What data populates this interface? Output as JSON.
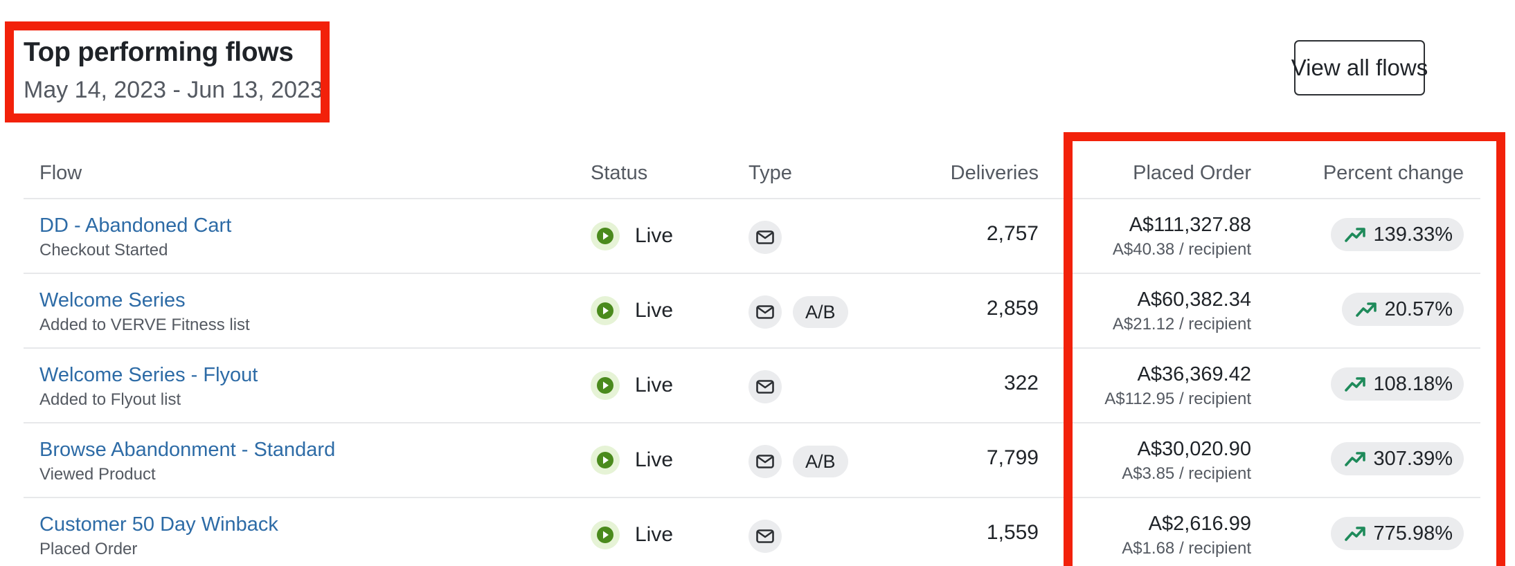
{
  "header": {
    "title": "Top performing flows",
    "date_range": "May 14, 2023 - Jun 13, 2023",
    "view_all_label": "View all flows"
  },
  "table": {
    "columns": {
      "flow": "Flow",
      "status": "Status",
      "type": "Type",
      "deliveries": "Deliveries",
      "placed_order": "Placed Order",
      "percent_change": "Percent change"
    },
    "rows": [
      {
        "name": "DD - Abandoned Cart",
        "trigger": "Checkout Started",
        "status": "Live",
        "type_icon": "mail-icon",
        "ab": "",
        "deliveries": "2,757",
        "placed_order": "A$111,327.88",
        "per_recipient": "A$40.38 / recipient",
        "percent_change": "139.33%"
      },
      {
        "name": "Welcome Series",
        "trigger": "Added to VERVE Fitness list",
        "status": "Live",
        "type_icon": "mail-icon",
        "ab": "A/B",
        "deliveries": "2,859",
        "placed_order": "A$60,382.34",
        "per_recipient": "A$21.12 / recipient",
        "percent_change": "20.57%"
      },
      {
        "name": "Welcome Series - Flyout",
        "trigger": "Added to Flyout list",
        "status": "Live",
        "type_icon": "mail-icon",
        "ab": "",
        "deliveries": "322",
        "placed_order": "A$36,369.42",
        "per_recipient": "A$112.95 / recipient",
        "percent_change": "108.18%"
      },
      {
        "name": "Browse Abandonment - Standard",
        "trigger": "Viewed Product",
        "status": "Live",
        "type_icon": "mail-icon",
        "ab": "A/B",
        "deliveries": "7,799",
        "placed_order": "A$30,020.90",
        "per_recipient": "A$3.85 / recipient",
        "percent_change": "307.39%"
      },
      {
        "name": "Customer 50 Day Winback",
        "trigger": "Placed Order",
        "status": "Live",
        "type_icon": "mail-icon",
        "ab": "",
        "deliveries": "1,559",
        "placed_order": "A$2,616.99",
        "per_recipient": "A$1.68 / recipient",
        "percent_change": "775.98%"
      }
    ]
  },
  "colors": {
    "link": "#2d6ba6",
    "live_green": "#4a8a1c",
    "trend_green": "#1e8a5a",
    "annotation_red": "#f2210a"
  }
}
